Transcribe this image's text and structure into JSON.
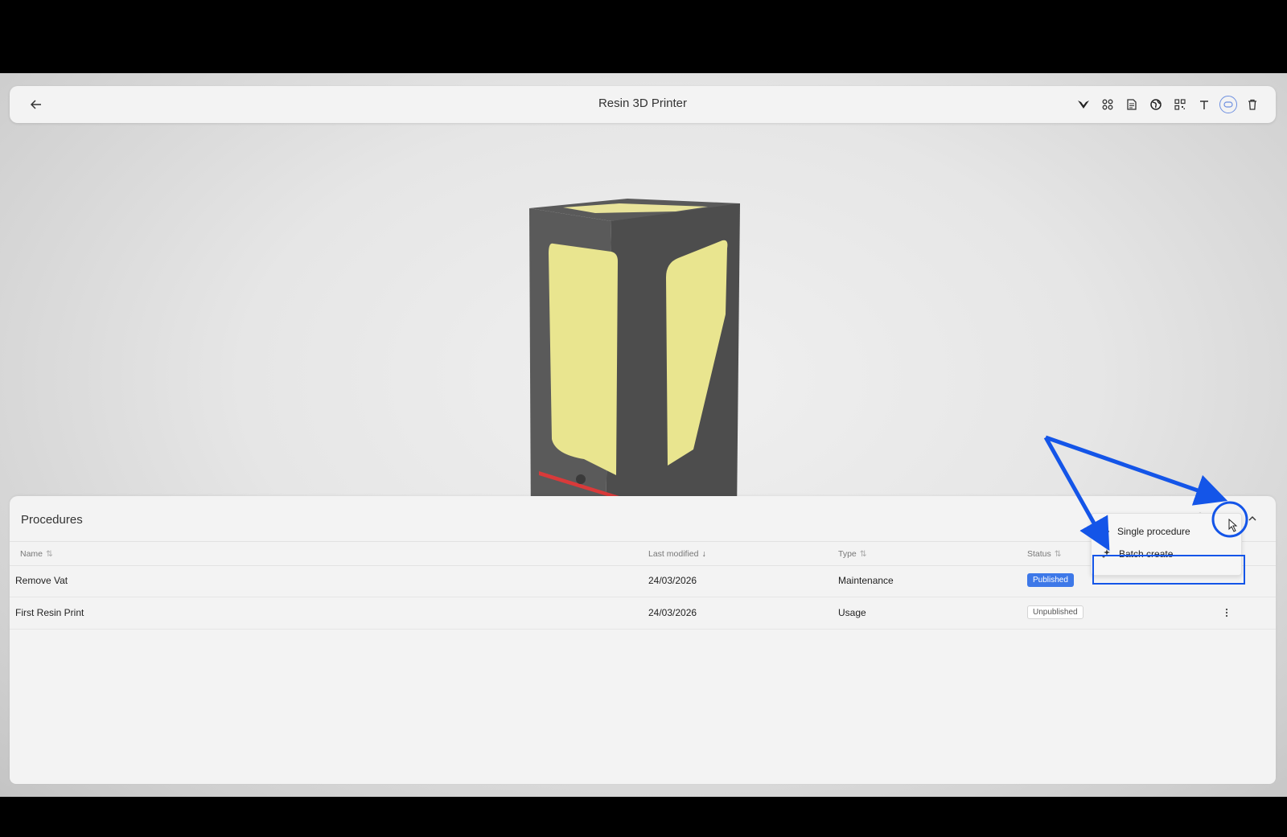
{
  "header": {
    "title": "Resin 3D Printer",
    "toolbar": [
      "wings-icon",
      "grid-icon",
      "document-icon",
      "globe-icon",
      "qr-icon",
      "text-icon",
      "circle-slider-icon",
      "trash-icon"
    ]
  },
  "procedures": {
    "title": "Procedures",
    "columns": {
      "name": "Name",
      "last_modified": "Last modified",
      "type": "Type",
      "status": "Status"
    },
    "rows": [
      {
        "name": "Remove Vat",
        "last_modified": "24/03/2026",
        "type": "Maintenance",
        "status": "Published"
      },
      {
        "name": "First Resin Print",
        "last_modified": "24/03/2026",
        "type": "Usage",
        "status": "Unpublished"
      }
    ]
  },
  "add_menu": {
    "single": "Single procedure",
    "batch": "Batch create"
  },
  "colors": {
    "accent": "#3d78e8",
    "annotation": "#1455e8"
  }
}
